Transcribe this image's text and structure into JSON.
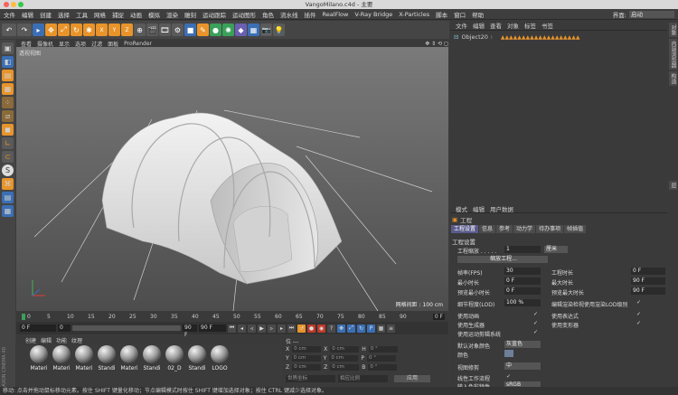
{
  "window": {
    "title": "VangoMilano.c4d - 主要"
  },
  "menu": [
    "文件",
    "编辑",
    "创建",
    "选择",
    "工具",
    "网格",
    "捕捉",
    "动画",
    "模拟",
    "渲染",
    "雕刻",
    "运动跟踪",
    "运动图形",
    "角色",
    "流水线",
    "插件",
    "RealFlow",
    "V-Ray Bridge",
    "X-Particles",
    "脚本",
    "窗口",
    "帮助"
  ],
  "interface": {
    "label": "界面:",
    "value": "启动"
  },
  "viewport": {
    "menu": [
      "查看",
      "摄像机",
      "显示",
      "选项",
      "过滤",
      "面板",
      "ProRender"
    ],
    "label": "透视视图",
    "grid_label": "网格间距 : 100 cm"
  },
  "timeline": {
    "ticks": [
      "0",
      "5",
      "10",
      "15",
      "20",
      "25",
      "30",
      "35",
      "40",
      "45",
      "50",
      "55",
      "60",
      "65",
      "70",
      "75",
      "80",
      "85",
      "90"
    ],
    "end_label": "0 F"
  },
  "playbar": {
    "start": "0 F",
    "cur": "0",
    "end_cur": "90 F",
    "end": "90 F"
  },
  "materials": {
    "menu": [
      "创建",
      "编辑",
      "功能",
      "纹理"
    ],
    "items": [
      "Materi",
      "Materi",
      "Materi",
      "Standi",
      "Materi",
      "Standi",
      "02_D",
      "Standi",
      "LOGO"
    ]
  },
  "coords": {
    "header": "位 ---",
    "rows": [
      {
        "a": "X",
        "av": "0 cm",
        "b": "X",
        "bv": "0 cm",
        "c": "H",
        "cv": "0 °"
      },
      {
        "a": "Y",
        "av": "0 cm",
        "b": "Y",
        "bv": "0 cm",
        "c": "P",
        "cv": "0 °"
      },
      {
        "a": "Z",
        "av": "0 cm",
        "b": "Z",
        "bv": "0 cm",
        "c": "B",
        "cv": "0 °"
      }
    ],
    "mode": "世界坐标",
    "scale": "相应比例",
    "apply": "应用"
  },
  "objects": {
    "menu": [
      "文件",
      "编辑",
      "查看",
      "对象",
      "标签",
      "书签"
    ],
    "item": "Object20"
  },
  "attributes": {
    "menu": [
      "模式",
      "编辑",
      "用户数据"
    ],
    "title": "工程",
    "tabs": [
      "工程设置",
      "信息",
      "参考",
      "动力学",
      "待办事项",
      "帧插值"
    ],
    "section": "工程设置",
    "scale_label": "工程缩放 . . . . .",
    "scale_value": "1",
    "scale_unit": "厘米",
    "scale_btn": "缩放工程...",
    "left_fields": [
      {
        "label": "帧率(FPS)",
        "value": "30"
      },
      {
        "label": "最小时长",
        "value": "0 F"
      },
      {
        "label": "预览最小时长",
        "value": "0 F"
      },
      {
        "label": "细节程度(LOD)",
        "value": "100 %"
      }
    ],
    "right_fields": [
      {
        "label": "工程时长",
        "value": "0 F"
      },
      {
        "label": "最大时长",
        "value": "90 F"
      },
      {
        "label": "预览最大时长",
        "value": "90 F"
      }
    ],
    "lod_note": "编辑渲染检视使用渲染LOD级别",
    "checks_left": [
      "使用动画",
      "使用生成器",
      "使用运动剪辑系统"
    ],
    "checks_right": [
      "使用表达式",
      "使用变形器"
    ],
    "default_color_label": "默认对象颜色",
    "default_color_value": "灰蓝色",
    "color_label": "颜色",
    "view_clip_label": "视图修剪",
    "view_clip_value": "中",
    "linear_label": "线性工作流程",
    "input_label": "输入色彩特性",
    "input_value": "sRGB"
  },
  "right_tabs": [
    "对象",
    "内容浏览器",
    "构造",
    "层"
  ],
  "status": "移动: 点击并拖动鼠标移动元素。按住 SHIFT 键量化移动；节点编辑模式时按住 SHIFT 键增加选择对象；按住 CTRL 键减少选择对象。",
  "colors": {
    "accent": "#5a5a8c",
    "toolbar_blue": "#3b6fb5",
    "toolbar_orange": "#e8942a",
    "toolbar_green": "#3aa05a"
  }
}
